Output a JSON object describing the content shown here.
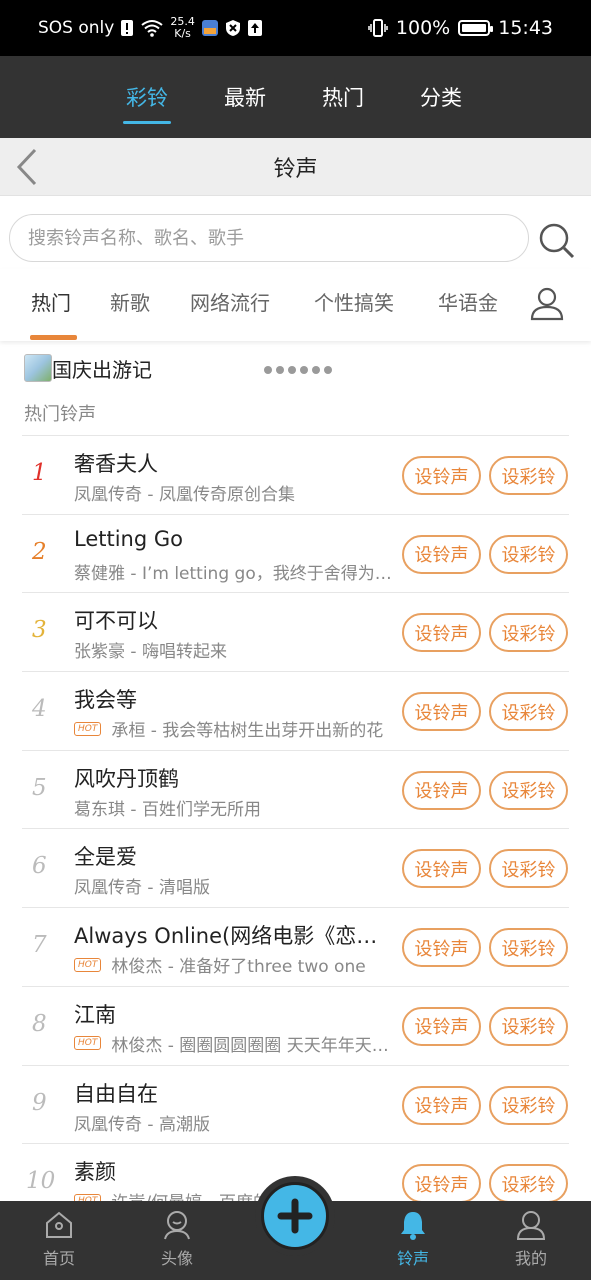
{
  "status_bar": {
    "carrier": "SOS only",
    "speed_value": "25.4",
    "speed_unit": "K/s",
    "battery": "100%",
    "time": "15:43"
  },
  "top_nav": {
    "tabs": [
      {
        "label": "彩铃",
        "active": true
      },
      {
        "label": "最新",
        "active": false
      },
      {
        "label": "热门",
        "active": false
      },
      {
        "label": "分类",
        "active": false
      }
    ]
  },
  "title_bar": {
    "title": "铃声"
  },
  "search": {
    "placeholder": "搜索铃声名称、歌名、歌手"
  },
  "categories": [
    {
      "label": "热门",
      "active": true
    },
    {
      "label": "新歌",
      "active": false
    },
    {
      "label": "网络流行",
      "active": false
    },
    {
      "label": "个性搞笑",
      "active": false
    },
    {
      "label": "华语金",
      "active": false
    }
  ],
  "banner": {
    "title": "国庆出游记"
  },
  "section_title": "热门铃声",
  "buttons": {
    "set_ringtone": "设铃声",
    "set_color_ring": "设彩铃"
  },
  "hot_badge": "HOT",
  "songs": [
    {
      "rank": "1",
      "title": "奢香夫人",
      "subtitle": "凤凰传奇 - 凤凰传奇原创合集",
      "hot": false
    },
    {
      "rank": "2",
      "title": "Letting Go",
      "subtitle": "蔡健雅 - I’m letting go，我终于舍得为你放开手，因为爱你爱到我心",
      "hot": false
    },
    {
      "rank": "3",
      "title": "可不可以",
      "subtitle": "张紫豪 - 嗨唱转起来",
      "hot": false
    },
    {
      "rank": "4",
      "title": "我会等",
      "subtitle": "承桓 - 我会等枯树生出芽开出新的花",
      "hot": true
    },
    {
      "rank": "5",
      "title": "风吹丹顶鹤",
      "subtitle": "葛东琪 - 百姓们学无所用",
      "hot": false
    },
    {
      "rank": "6",
      "title": "全是爱",
      "subtitle": "凤凰传奇 - 清唱版",
      "hot": false
    },
    {
      "rank": "7",
      "title": "Always Online(网络电影《恋爱回旋》主题曲)",
      "subtitle": "林俊杰 - 准备好了three two one",
      "hot": true
    },
    {
      "rank": "8",
      "title": "江南",
      "subtitle": "林俊杰 - 圈圈圆圆圈圈 天天年年天天的我",
      "hot": true
    },
    {
      "rank": "9",
      "title": "自由自在",
      "subtitle": "凤凰传奇 - 高潮版",
      "hot": false
    },
    {
      "rank": "10",
      "title": "素颜",
      "subtitle": "许嵩/何曼婷 - 百度的校",
      "hot": true
    }
  ],
  "bottom_nav": {
    "home": "首页",
    "avatar": "头像",
    "ringtone": "铃声",
    "mine": "我的"
  },
  "colors": {
    "accent": "#44b7e6",
    "orange": "#e8863a",
    "rank1": "#e0312b",
    "rank2": "#e6802b",
    "rank3": "#e3b33a"
  }
}
